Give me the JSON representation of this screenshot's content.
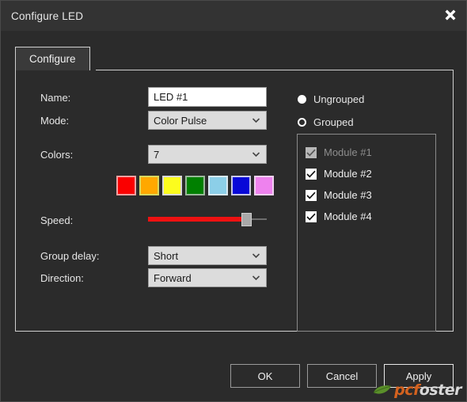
{
  "window": {
    "title": "Configure LED",
    "close_icon": "close-icon"
  },
  "tabs": [
    {
      "label": "Configure",
      "selected": true
    }
  ],
  "form": {
    "name": {
      "label": "Name:",
      "value": "LED #1",
      "placeholder": ""
    },
    "mode": {
      "label": "Mode:",
      "value": "Color Pulse",
      "chevron_icon": "chevron-down-icon"
    },
    "colors": {
      "label": "Colors:",
      "value": "7",
      "chevron_icon": "chevron-down-icon"
    },
    "speed": {
      "label": "Speed:",
      "value_percent": 80,
      "fill_color": "#ee1111",
      "thumb_color": "#a9a9a9"
    },
    "group_delay": {
      "label": "Group delay:",
      "value": "Short",
      "chevron_icon": "chevron-down-icon"
    },
    "direction": {
      "label": "Direction:",
      "value": "Forward",
      "chevron_icon": "chevron-down-icon"
    }
  },
  "swatches": [
    {
      "name": "red",
      "fill": "#fa0000",
      "border": "#f0a0a0"
    },
    {
      "name": "orange",
      "fill": "#ffa800",
      "border": "#d8d860"
    },
    {
      "name": "yellow",
      "fill": "#fcfc1e",
      "border": "#d8d8d8"
    },
    {
      "name": "green",
      "fill": "#008000",
      "border": "#9ab89a"
    },
    {
      "name": "lightblue",
      "fill": "#8ccfe8",
      "border": "#d8e8f0"
    },
    {
      "name": "blue",
      "fill": "#0808d8",
      "border": "#c8c8e8"
    },
    {
      "name": "violet",
      "fill": "#ee82ee",
      "border": "#f0d0f0"
    }
  ],
  "grouping": {
    "options": [
      {
        "label": "Ungrouped",
        "selected": false
      },
      {
        "label": "Grouped",
        "selected": true
      }
    ]
  },
  "modules": [
    {
      "label": "Module #1",
      "checked": true,
      "enabled": false
    },
    {
      "label": "Module #2",
      "checked": true,
      "enabled": true
    },
    {
      "label": "Module #3",
      "checked": true,
      "enabled": true
    },
    {
      "label": "Module #4",
      "checked": true,
      "enabled": true
    }
  ],
  "footer": {
    "ok": "OK",
    "cancel": "Cancel",
    "apply": "Apply"
  },
  "watermark": {
    "part_a": "pcf",
    "part_b": "oster",
    "leaf_icon": "leaf-icon"
  }
}
